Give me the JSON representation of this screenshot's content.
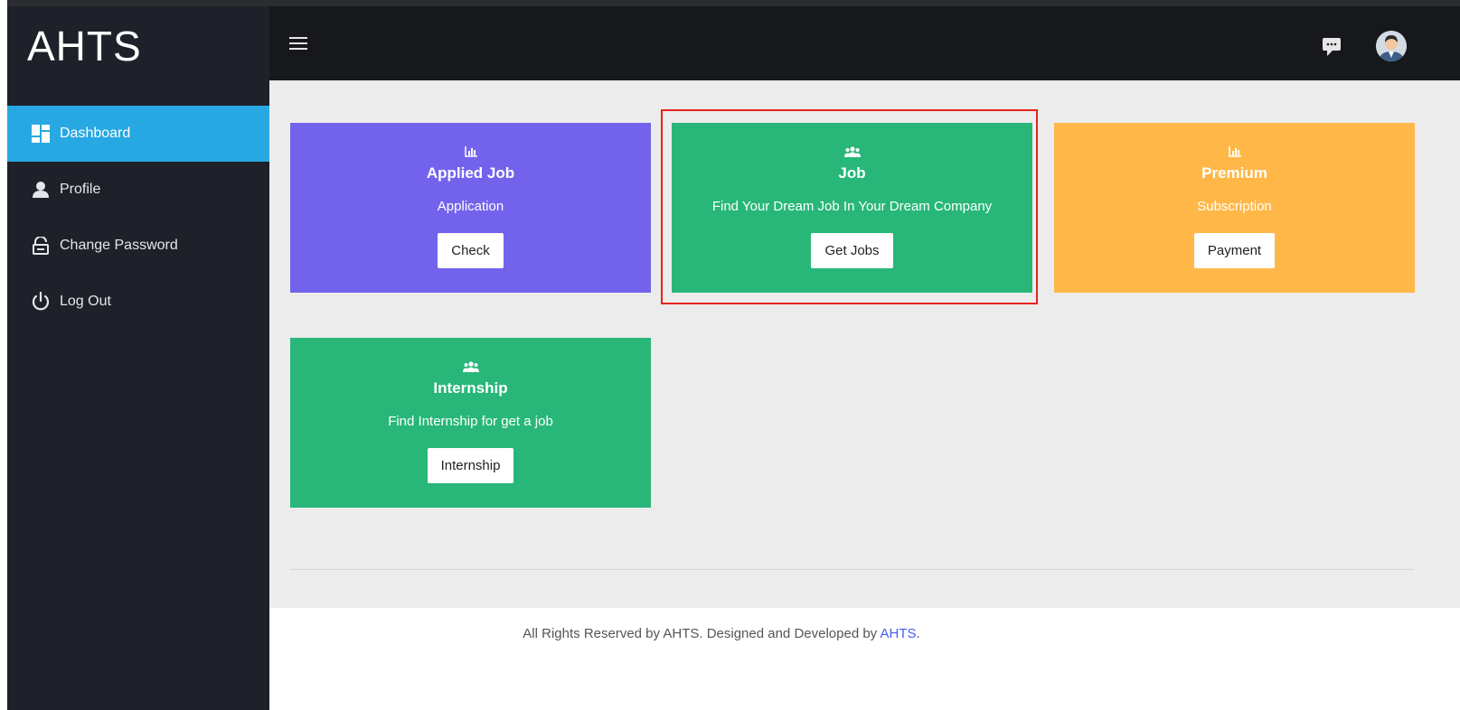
{
  "brand": "AHTS",
  "sidebar": {
    "items": [
      {
        "label": "Dashboard",
        "icon": "dashboard-icon",
        "active": true
      },
      {
        "label": "Profile",
        "icon": "user-icon"
      },
      {
        "label": "Change Password",
        "icon": "unlock-icon"
      },
      {
        "label": "Log Out",
        "icon": "power-icon"
      }
    ]
  },
  "cards": [
    {
      "icon": "bar-chart-icon",
      "title": "Applied Job",
      "subtitle": "Application",
      "button": "Check",
      "color": "#7363ec"
    },
    {
      "icon": "users-icon",
      "title": "Job",
      "subtitle": "Find Your Dream Job In Your Dream Company",
      "button": "Get Jobs",
      "color": "#28b779"
    },
    {
      "icon": "bar-chart-icon",
      "title": "Premium",
      "subtitle": "Subscription",
      "button": "Payment",
      "color": "#ffb848"
    },
    {
      "icon": "users-icon",
      "title": "Internship",
      "subtitle": "Find Internship for get a job",
      "button": "Internship",
      "color": "#28b779"
    }
  ],
  "footer": {
    "text": "All Rights Reserved by AHTS. Designed and Developed by",
    "link": "AHTS",
    "suffix": "."
  },
  "colors": {
    "sidebar_bg": "#1e2129",
    "active_accent": "#28a8e3",
    "topbar_bg": "#17181c",
    "highlight": "#e8221f"
  }
}
